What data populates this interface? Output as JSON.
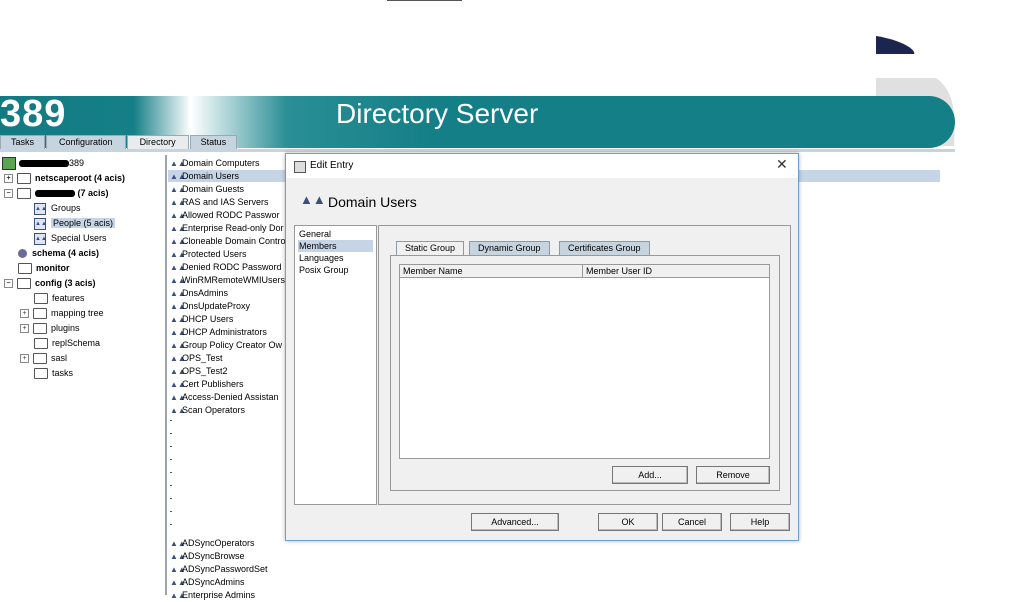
{
  "header": {
    "logo_num": "389",
    "title": "Directory Server"
  },
  "tabs": [
    "Tasks",
    "Configuration",
    "Directory",
    "Status"
  ],
  "active_tab": "Directory",
  "tree": {
    "root_suffix": "389",
    "netscaperoot": "netscaperoot  (4 acis)",
    "domain_acis": "(7 acis)",
    "groups": "Groups",
    "people": "People",
    "people_acis": "(5 acis)",
    "special_users": "Special Users",
    "schema": "schema  (4 acis)",
    "monitor": "monitor",
    "config": "config  (3 acis)",
    "features": "features",
    "mapping_tree": "mapping tree",
    "plugins": "plugins",
    "replschema": "replSchema",
    "sasl": "sasl",
    "tasks": "tasks"
  },
  "list_top": [
    "Domain Computers",
    "Domain Users",
    "Domain Guests",
    "RAS and IAS Servers",
    "Allowed RODC Passwor",
    "Enterprise Read-only Dor",
    "Cloneable Domain Contro",
    "Protected Users",
    "Denied RODC Password",
    "WinRMRemoteWMIUsers_",
    "DnsAdmins",
    "DnsUpdateProxy",
    "DHCP Users",
    "DHCP Administrators",
    "Group Policy Creator Ow",
    "OPS_Test",
    "OPS_Test2",
    "Cert Publishers",
    "Access-Denied Assistan",
    "Scan Operators"
  ],
  "list_bottom": [
    "ADSyncOperators",
    "ADSyncBrowse",
    "ADSyncPasswordSet",
    "ADSyncAdmins",
    "Enterprise Admins"
  ],
  "dialog": {
    "title": "Edit Entry",
    "heading": "Domain Users",
    "side_items": [
      "General",
      "Members",
      "Languages",
      "Posix Group"
    ],
    "selected_side": "Members",
    "inner_tabs": [
      "Static Group",
      "Dynamic Group",
      "Certificates Group"
    ],
    "columns": [
      "Member Name",
      "Member User ID"
    ],
    "add_label": "Add...",
    "remove_label": "Remove",
    "advanced_label": "Advanced...",
    "ok_label": "OK",
    "cancel_label": "Cancel",
    "help_label": "Help"
  }
}
